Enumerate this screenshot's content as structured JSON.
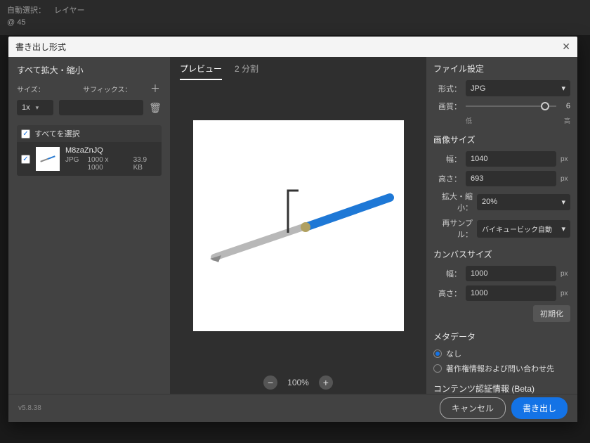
{
  "app_bg": {
    "auto_select": "自動選択：",
    "layer": "レイヤー",
    "zoom45": "@ 45"
  },
  "dialog": {
    "title": "書き出し形式"
  },
  "left": {
    "scale_title": "すべて拡大・縮小",
    "size_label": "サイズ：",
    "size_value": "1x",
    "suffix_label": "サフィックス：",
    "select_all_label": "すべてを選択"
  },
  "asset": {
    "name": "M8zaZnJQ",
    "format": "JPG",
    "dimensions": "1000 x 1000",
    "filesize": "33.9 KB"
  },
  "center": {
    "tab_preview": "プレビュー",
    "tab_split": "2 分割",
    "zoom_value": "100%"
  },
  "right": {
    "file_settings_title": "ファイル設定",
    "format_label": "形式：",
    "format_value": "JPG",
    "quality_label": "画質：",
    "quality_value": "6",
    "quality_low": "低",
    "quality_high": "高",
    "image_size_title": "画像サイズ",
    "width_label": "幅：",
    "width_value": "1040",
    "height_label": "高さ：",
    "height_value": "693",
    "scale_label": "拡大・縮小：",
    "scale_value": "20%",
    "resample_label": "再サンプル：",
    "resample_value": "バイキュービック自動",
    "px": "px",
    "canvas_size_title": "カンバスサイズ",
    "canvas_width_value": "1000",
    "canvas_height_value": "1000",
    "reset_label": "初期化",
    "metadata_title": "メタデータ",
    "metadata_none": "なし",
    "metadata_copyright": "著作権情報および問い合わせ先",
    "content_auth_title": "コンテンツ認証情報 (Beta)"
  },
  "footer": {
    "version": "v5.8.38",
    "cancel": "キャンセル",
    "export": "書き出し"
  }
}
